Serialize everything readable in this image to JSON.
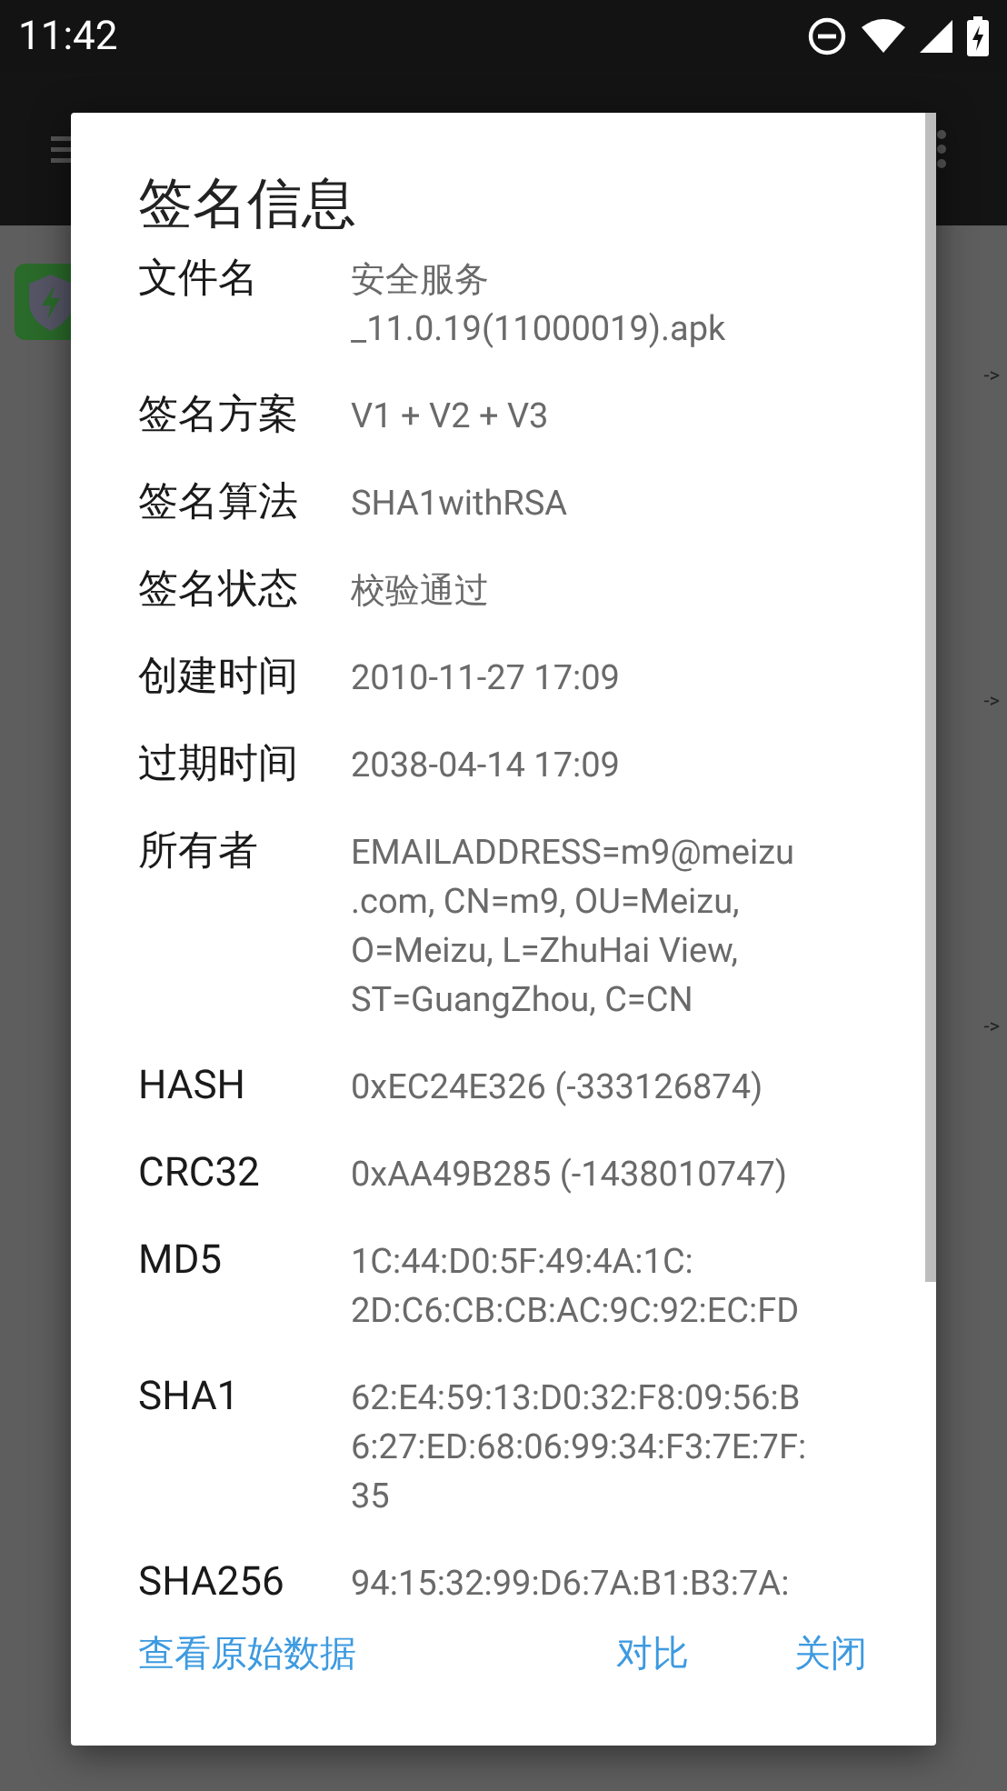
{
  "status_bar": {
    "time": "11:42"
  },
  "background_list": {
    "arrows": [
      "->",
      "->",
      "->"
    ]
  },
  "dialog": {
    "title": "签名信息",
    "fields": [
      {
        "label": "文件名",
        "value": "安全服务\n_11.0.19(11000019).apk"
      },
      {
        "label": "签名方案",
        "value": "V1 + V2 + V3"
      },
      {
        "label": "签名算法",
        "value": "SHA1withRSA"
      },
      {
        "label": "签名状态",
        "value": "校验通过"
      },
      {
        "label": "创建时间",
        "value": "2010-11-27 17:09"
      },
      {
        "label": "过期时间",
        "value": "2038-04-14 17:09"
      },
      {
        "label": "所有者",
        "value": "EMAILADDRESS=m9@meizu\n.com, CN=m9, OU=Meizu,\nO=Meizu, L=ZhuHai View,\nST=GuangZhou, C=CN"
      },
      {
        "label": "HASH",
        "value": "0xEC24E326 (-333126874)"
      },
      {
        "label": "CRC32",
        "value": "0xAA49B285 (-1438010747)"
      },
      {
        "label": "MD5",
        "value": "1C:44:D0:5F:49:4A:1C:\n2D:C6:CB:CB:AC:9C:92:EC:FD"
      },
      {
        "label": "SHA1",
        "value": "62:E4:59:13:D0:32:F8:09:56:B\n6:27:ED:68:06:99:34:F3:7E:7F:\n35"
      },
      {
        "label": "SHA256",
        "value": "94:15:32:99:D6:7A:B1:B3:7A:"
      }
    ],
    "buttons": [
      {
        "label": "查看原始数据",
        "kind": "left"
      },
      {
        "label": "对比",
        "kind": "right"
      },
      {
        "label": "关闭",
        "kind": "right"
      }
    ]
  }
}
